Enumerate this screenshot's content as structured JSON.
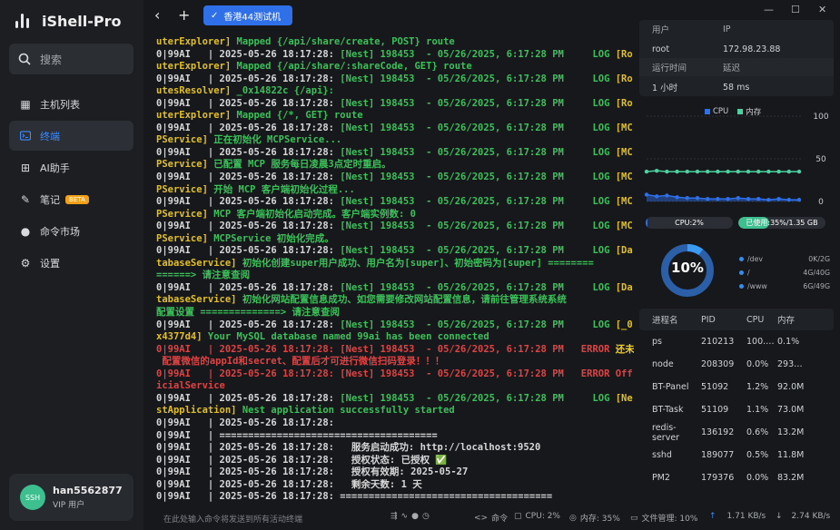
{
  "app": {
    "title": "iShell-Pro"
  },
  "search": {
    "label": "搜索"
  },
  "nav": [
    {
      "label": "主机列表",
      "icon": "grid-icon",
      "glyph": "▦"
    },
    {
      "label": "终端",
      "icon": "terminal-icon",
      "glyph": "⌨"
    },
    {
      "label": "AI助手",
      "icon": "ai-chip-icon",
      "glyph": "⊞"
    },
    {
      "label": "笔记",
      "icon": "pen-icon",
      "glyph": "✎",
      "badge": "BETA"
    },
    {
      "label": "命令市场",
      "icon": "bulb-icon",
      "glyph": "●"
    },
    {
      "label": "设置",
      "icon": "gear-icon",
      "glyph": "⚙"
    }
  ],
  "user": {
    "avatar": "SSH",
    "name": "han5562877",
    "tag": "VIP 用户"
  },
  "tabs": [
    {
      "label": "香港44测试机"
    }
  ],
  "terminal": {
    "lines": [
      [
        [
          "uterExplorer] ",
          "y"
        ],
        [
          "Mapped {/api/share/create, POST} route",
          "g"
        ]
      ],
      [
        [
          "0|99AI   | 2025-05-26 18:17:28: ",
          "w"
        ],
        [
          "[Nest] 198453  - 05/26/2025, 6:17:28 PM     LOG ",
          "g"
        ],
        [
          "[Ro",
          "y"
        ]
      ],
      [
        [
          "uterExplorer] ",
          "y"
        ],
        [
          "Mapped {/api/share/:shareCode, GET} route",
          "g"
        ]
      ],
      [
        [
          "0|99AI   | 2025-05-26 18:17:28: ",
          "w"
        ],
        [
          "[Nest] 198453  - 05/26/2025, 6:17:28 PM     LOG ",
          "g"
        ],
        [
          "[Ro",
          "y"
        ]
      ],
      [
        [
          "utesResolver] ",
          "y"
        ],
        [
          "_0x14822c {/api}:",
          "g"
        ]
      ],
      [
        [
          "0|99AI   | 2025-05-26 18:17:28: ",
          "w"
        ],
        [
          "[Nest] 198453  - 05/26/2025, 6:17:28 PM     LOG ",
          "g"
        ],
        [
          "[Ro",
          "y"
        ]
      ],
      [
        [
          "uterExplorer] ",
          "y"
        ],
        [
          "Mapped {/*, GET} route",
          "g"
        ]
      ],
      [
        [
          "0|99AI   | 2025-05-26 18:17:28: ",
          "w"
        ],
        [
          "[Nest] 198453  - 05/26/2025, 6:17:28 PM     LOG ",
          "g"
        ],
        [
          "[MC",
          "y"
        ]
      ],
      [
        [
          "PService] ",
          "y"
        ],
        [
          "正在初始化 MCPService...",
          "g"
        ]
      ],
      [
        [
          "0|99AI   | 2025-05-26 18:17:28: ",
          "w"
        ],
        [
          "[Nest] 198453  - 05/26/2025, 6:17:28 PM     LOG ",
          "g"
        ],
        [
          "[MC",
          "y"
        ]
      ],
      [
        [
          "PService] ",
          "y"
        ],
        [
          "已配置 MCP 服务每日凌晨3点定时重启。",
          "g"
        ]
      ],
      [
        [
          "0|99AI   | 2025-05-26 18:17:28: ",
          "w"
        ],
        [
          "[Nest] 198453  - 05/26/2025, 6:17:28 PM     LOG ",
          "g"
        ],
        [
          "[MC",
          "y"
        ]
      ],
      [
        [
          "PService] ",
          "y"
        ],
        [
          "开始 MCP 客户端初始化过程...",
          "g"
        ]
      ],
      [
        [
          "0|99AI   | 2025-05-26 18:17:28: ",
          "w"
        ],
        [
          "[Nest] 198453  - 05/26/2025, 6:17:28 PM     LOG ",
          "g"
        ],
        [
          "[MC",
          "y"
        ]
      ],
      [
        [
          "PService] ",
          "y"
        ],
        [
          "MCP 客户端初始化启动完成。客户端实例数: 0",
          "g"
        ]
      ],
      [
        [
          "0|99AI   | 2025-05-26 18:17:28: ",
          "w"
        ],
        [
          "[Nest] 198453  - 05/26/2025, 6:17:28 PM     LOG ",
          "g"
        ],
        [
          "[MC",
          "y"
        ]
      ],
      [
        [
          "PService] ",
          "y"
        ],
        [
          "MCPService 初始化完成。",
          "g"
        ]
      ],
      [
        [
          "0|99AI   | 2025-05-26 18:17:28: ",
          "w"
        ],
        [
          "[Nest] 198453  - 05/26/2025, 6:17:28 PM     LOG ",
          "g"
        ],
        [
          "[Da",
          "y"
        ]
      ],
      [
        [
          "tabaseService] ",
          "y"
        ],
        [
          "初始化创建super用户成功、用户名为[super]、初始密码为[super] ========",
          "g"
        ]
      ],
      [
        [
          "======> 请注意查阅",
          "g"
        ]
      ],
      [
        [
          "0|99AI   | 2025-05-26 18:17:28: ",
          "w"
        ],
        [
          "[Nest] 198453  - 05/26/2025, 6:17:28 PM     LOG ",
          "g"
        ],
        [
          "[Da",
          "y"
        ]
      ],
      [
        [
          "tabaseService] ",
          "y"
        ],
        [
          "初始化网站配置信息成功、如您需要修改网站配置信息，请前往管理系统系统",
          "g"
        ]
      ],
      [
        [
          "配置设置 ==============> 请注意查阅",
          "g"
        ]
      ],
      [
        [
          "0|99AI   | 2025-05-26 18:17:28: ",
          "w"
        ],
        [
          "[Nest] 198453  - 05/26/2025, 6:17:28 PM     LOG ",
          "g"
        ],
        [
          "[_0",
          "y"
        ]
      ],
      [
        [
          "x4377d4] ",
          "y"
        ],
        [
          "Your MySQL database named 99ai has been connected",
          "g"
        ]
      ],
      [
        [
          "0|99AI   | 2025-05-26 18:17:28: ",
          "r"
        ],
        [
          "[Nest] 198453  - 05/26/2025, 6:17:28 PM   ERROR ",
          "r"
        ],
        [
          "还未",
          "yb"
        ]
      ],
      [
        [
          " 配置微信的appId和secret、配置后才可进行微信扫码登录！！！",
          "r"
        ]
      ],
      [
        [
          "0|99AI   | 2025-05-26 18:17:28: ",
          "r"
        ],
        [
          "[Nest] 198453  - 05/26/2025, 6:17:28 PM   ERROR ",
          "r"
        ],
        [
          "Off",
          "r"
        ]
      ],
      [
        [
          "icialService",
          "r"
        ]
      ],
      [
        [
          "0|99AI   | 2025-05-26 18:17:28: ",
          "w"
        ],
        [
          "[Nest] 198453  - 05/26/2025, 6:17:28 PM     LOG ",
          "g"
        ],
        [
          "[Ne",
          "y"
        ]
      ],
      [
        [
          "stApplication] ",
          "y"
        ],
        [
          "Nest application successfully started",
          "g"
        ]
      ],
      [
        [
          "0|99AI   | 2025-05-26 18:17:28:",
          "w"
        ]
      ],
      [
        [
          "0|99AI   | ======================================",
          "w"
        ]
      ],
      [
        [
          "0|99AI   | 2025-05-26 18:17:28:   服务启动成功: http://localhost:9520",
          "w"
        ]
      ],
      [
        [
          "0|99AI   | 2025-05-26 18:17:28:   授权状态: 已授权 ",
          "w"
        ],
        [
          "✅",
          "g"
        ]
      ],
      [
        [
          "0|99AI   | 2025-05-26 18:17:28:   授权有效期: 2025-05-27",
          "w"
        ]
      ],
      [
        [
          "0|99AI   | 2025-05-26 18:17:28:   剩余天数: 1 天",
          "w"
        ]
      ],
      [
        [
          "0|99AI   | 2025-05-26 18:17:28: =====================================",
          "w"
        ]
      ]
    ]
  },
  "status": {
    "input_placeholder": "在此处输入命令将发送到所有活动终端",
    "cmd_label": "命令",
    "cpu": "CPU: 2%",
    "mem": "内存: 35%",
    "files": "文件管理: 10%",
    "up": "1.71 KB/s",
    "down": "2.74 KB/s"
  },
  "server": {
    "user_label": "用户",
    "ip_label": "IP",
    "user": "root",
    "ip": "172.98.23.88",
    "uptime_label": "运行时间",
    "latency_label": "延迟",
    "uptime": "1 小时",
    "latency": "58 ms"
  },
  "chart_data": {
    "type": "line",
    "series": [
      {
        "name": "CPU",
        "color": "#2f6fe8",
        "values": [
          8,
          6,
          7,
          5,
          4,
          4,
          3,
          3,
          3,
          4,
          3,
          3,
          2,
          3,
          2,
          2
        ]
      },
      {
        "name": "内存",
        "color": "#4ed1a0",
        "values": [
          35,
          36,
          35,
          35,
          35,
          35,
          35,
          35,
          35,
          35,
          35,
          35,
          35,
          35,
          35,
          35
        ]
      }
    ],
    "ylim": [
      0,
      100
    ],
    "yticks": [
      "100",
      "50",
      "0"
    ]
  },
  "usage": {
    "cpu_label": "CPU:2%",
    "cpu_pct": 0.02,
    "mem_label": "已使用:35%/1.35 GB",
    "mem_pct": 0.35
  },
  "disk": {
    "pct_label": "10%",
    "pct": 0.1,
    "mounts": [
      {
        "name": "/dev",
        "usage": "0K/2G"
      },
      {
        "name": "/",
        "usage": "4G/40G"
      },
      {
        "name": "/www",
        "usage": "6G/49G"
      }
    ]
  },
  "processes": {
    "headers": [
      "进程名",
      "PID",
      "CPU",
      "内存"
    ],
    "rows": [
      [
        "ps",
        "210213",
        "100.…",
        "0.1%"
      ],
      [
        "node",
        "208309",
        "0.0%",
        "293…"
      ],
      [
        "BT-Panel",
        "51092",
        "1.2%",
        "92.0M"
      ],
      [
        "BT-Task",
        "51109",
        "1.1%",
        "73.0M"
      ],
      [
        "redis-server",
        "136192",
        "0.6%",
        "13.2M"
      ],
      [
        "sshd",
        "189077",
        "0.5%",
        "11.8M"
      ],
      [
        "PM2",
        "179376",
        "0.0%",
        "83.2M"
      ]
    ]
  }
}
